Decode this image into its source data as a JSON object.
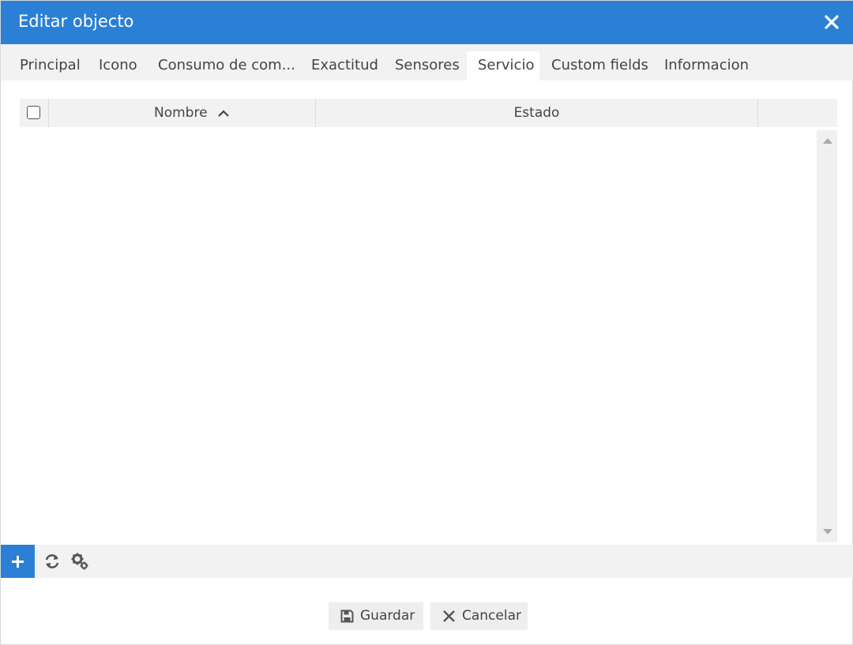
{
  "window": {
    "title": "Editar objecto"
  },
  "tabs": [
    {
      "label": "Principal"
    },
    {
      "label": "Icono"
    },
    {
      "label": "Consumo de com..."
    },
    {
      "label": "Exactitud"
    },
    {
      "label": "Sensores"
    },
    {
      "label": "Servicio",
      "active": true
    },
    {
      "label": "Custom fields"
    },
    {
      "label": "Informacion"
    }
  ],
  "grid": {
    "columns": [
      {
        "label": "Nombre",
        "sort": "ascending"
      },
      {
        "label": "Estado"
      }
    ],
    "rows": []
  },
  "toolbar": {
    "icons": [
      "plus-icon",
      "refresh-icon",
      "gears-icon"
    ]
  },
  "buttons": {
    "save_label": "Guardar",
    "cancel_label": "Cancelar"
  },
  "colors": {
    "accent": "#2b80d6",
    "panel": "#f2f2f2"
  }
}
